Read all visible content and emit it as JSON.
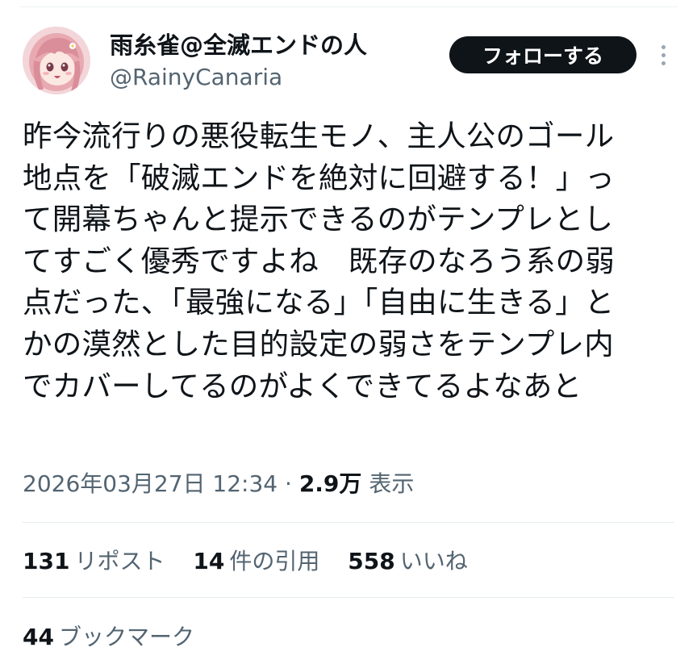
{
  "author": {
    "display_name": "雨糸雀@全滅エンドの人",
    "handle": "@RainyCanaria"
  },
  "follow_button_label": "フォローする",
  "tweet": {
    "lines": [
      "昨今流行りの悪役転生モノ、主人公のゴール",
      "地点を「破滅エンドを絶対に回避する！」っ",
      "て開幕ちゃんと提示できるのがテンプレとし",
      "てすごく優秀ですよね　既存のなろう系の弱",
      "点だった、「最強になる」「自由に生きる」と",
      "かの漠然とした目的設定の弱さをテンプレ内",
      "でカバーしてるのがよくできてるよなあと"
    ]
  },
  "meta": {
    "timestamp": "2026年03月27日 12:34",
    "separator": " · ",
    "views_count": "2.9万",
    "views_label": "表示"
  },
  "stats": {
    "reposts_count": "131",
    "reposts_label": "リポスト",
    "quotes_count": "14",
    "quotes_label": "件の引用",
    "likes_count": "558",
    "likes_label": "いいね",
    "bookmarks_count": "44",
    "bookmarks_label": "ブックマーク"
  },
  "icons": {
    "more": "more-vertical-icon",
    "avatar": "avatar-image"
  },
  "colors": {
    "text_primary": "#0f1419",
    "text_secondary": "#536471",
    "button_bg": "#0f1419",
    "divider": "#e6ecf0"
  }
}
